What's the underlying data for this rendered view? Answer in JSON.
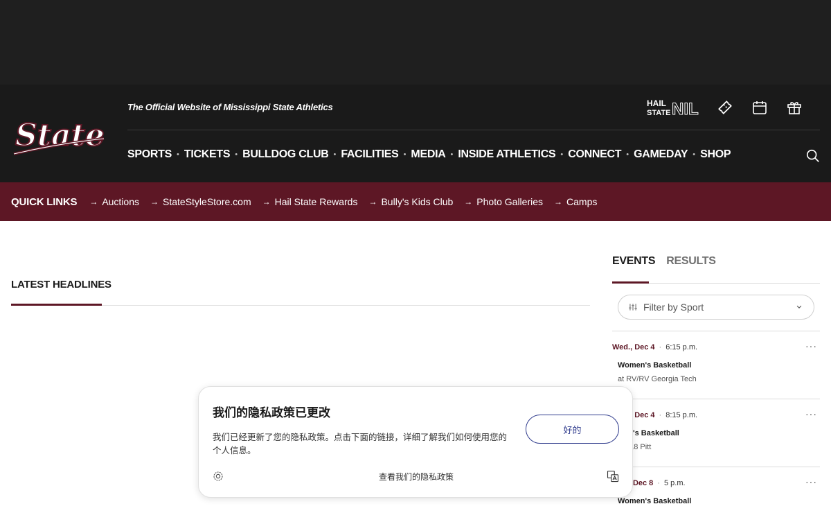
{
  "header": {
    "tagline": "The Official Website of Mississippi State Athletics",
    "hail_logo_text": [
      "HAIL",
      "STATE",
      "NIL"
    ],
    "logo_text": "State"
  },
  "nav": {
    "items": [
      "SPORTS",
      "TICKETS",
      "BULLDOG CLUB",
      "FACILITIES",
      "MEDIA",
      "INSIDE ATHLETICS",
      "CONNECT",
      "GAMEDAY",
      "SHOP"
    ]
  },
  "quick_links": {
    "title": "QUICK LINKS",
    "items": [
      "Auctions",
      "StateStyleStore.com",
      "Hail State Rewards",
      "Bully's Kids Club",
      "Photo Galleries",
      "Camps"
    ]
  },
  "headlines": {
    "title": "LATEST HEADLINES"
  },
  "events": {
    "tabs": [
      "EVENTS",
      "RESULTS"
    ],
    "filter_label": "Filter by Sport",
    "items": [
      {
        "date": "Wed., Dec 4",
        "time": "6:15 p.m.",
        "sport": "Women's Basketball",
        "opponent": "at RV/RV Georgia Tech"
      },
      {
        "date": "Wed., Dec 4",
        "time": "8:15 p.m.",
        "sport": "Men's Basketball",
        "opponent": "vs. 18 Pitt"
      },
      {
        "date": "Sun., Dec 8",
        "time": "5 p.m.",
        "sport": "Women's Basketball",
        "opponent": ""
      }
    ],
    "more_label": "···"
  },
  "privacy_modal": {
    "title": "我们的隐私政策已更改",
    "text": "我们已经更新了您的隐私政策。点击下面的链接，详细了解我们如何使用您的个人信息。",
    "ok_label": "好的",
    "link_label": "查看我们的隐私政策"
  },
  "colors": {
    "maroon": "#5d1725",
    "header_bg": "#1a1a1a",
    "button_blue": "#2e3a8c"
  },
  "icons": [
    "ticket-icon",
    "calendar-icon",
    "gift-icon",
    "search-icon",
    "filter-icon",
    "chevron-down-icon",
    "gear-icon",
    "translate-icon"
  ]
}
